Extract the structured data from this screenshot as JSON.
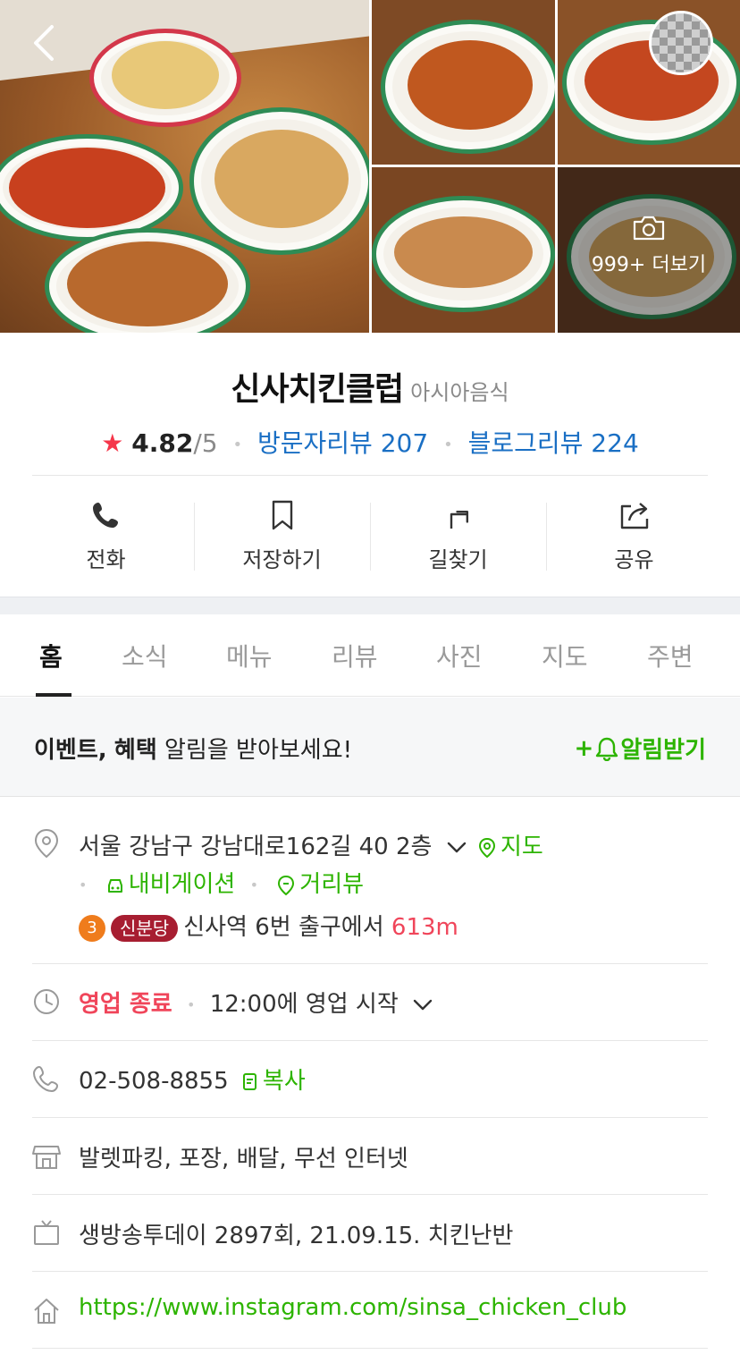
{
  "header": {
    "more_photos_label": "999+ 더보기"
  },
  "place": {
    "name": "신사치킨클럽",
    "category": "아시아음식",
    "rating": "4.82",
    "rating_max": "/5",
    "visitor_reviews": "방문자리뷰 207",
    "blog_reviews": "블로그리뷰 224"
  },
  "actions": [
    {
      "label": "전화",
      "icon": "phone-icon"
    },
    {
      "label": "저장하기",
      "icon": "bookmark-icon"
    },
    {
      "label": "길찾기",
      "icon": "directions-icon"
    },
    {
      "label": "공유",
      "icon": "share-icon"
    }
  ],
  "tabs": [
    "홈",
    "소식",
    "메뉴",
    "리뷰",
    "사진",
    "지도",
    "주변"
  ],
  "active_tab": "홈",
  "event": {
    "bold1": "이벤트,",
    "bold2": "혜택",
    "rest": "알림을 받아보세요!",
    "button": "+",
    "button_label": "알림받기"
  },
  "info": {
    "address": "서울 강남구 강남대로162길 40 2층",
    "map_link": "지도",
    "navigation_link": "내비게이션",
    "streetview_link": "거리뷰",
    "subway_line": "3",
    "station_name": "신분당",
    "station_directions": "신사역 6번 출구에서",
    "station_distance": "613m",
    "business_status": "영업 종료",
    "business_hours": "12:00에 영업 시작",
    "phone": "02-508-8855",
    "copy_label": "복사",
    "amenities": "발렛파킹, 포장, 배달, 무선 인터넷",
    "tv": "생방송투데이 2897회, 21.09.15. 치킨난반",
    "website": "https://www.instagram.com/sinsa_chicken_club"
  },
  "colors": {
    "accent_green": "#2db400",
    "link_blue": "#1a6fc4",
    "star_red": "#f5364a",
    "closed_red": "#f0455a",
    "line3_orange": "#ef7c1c",
    "sinbundang_red": "#a71e31"
  }
}
